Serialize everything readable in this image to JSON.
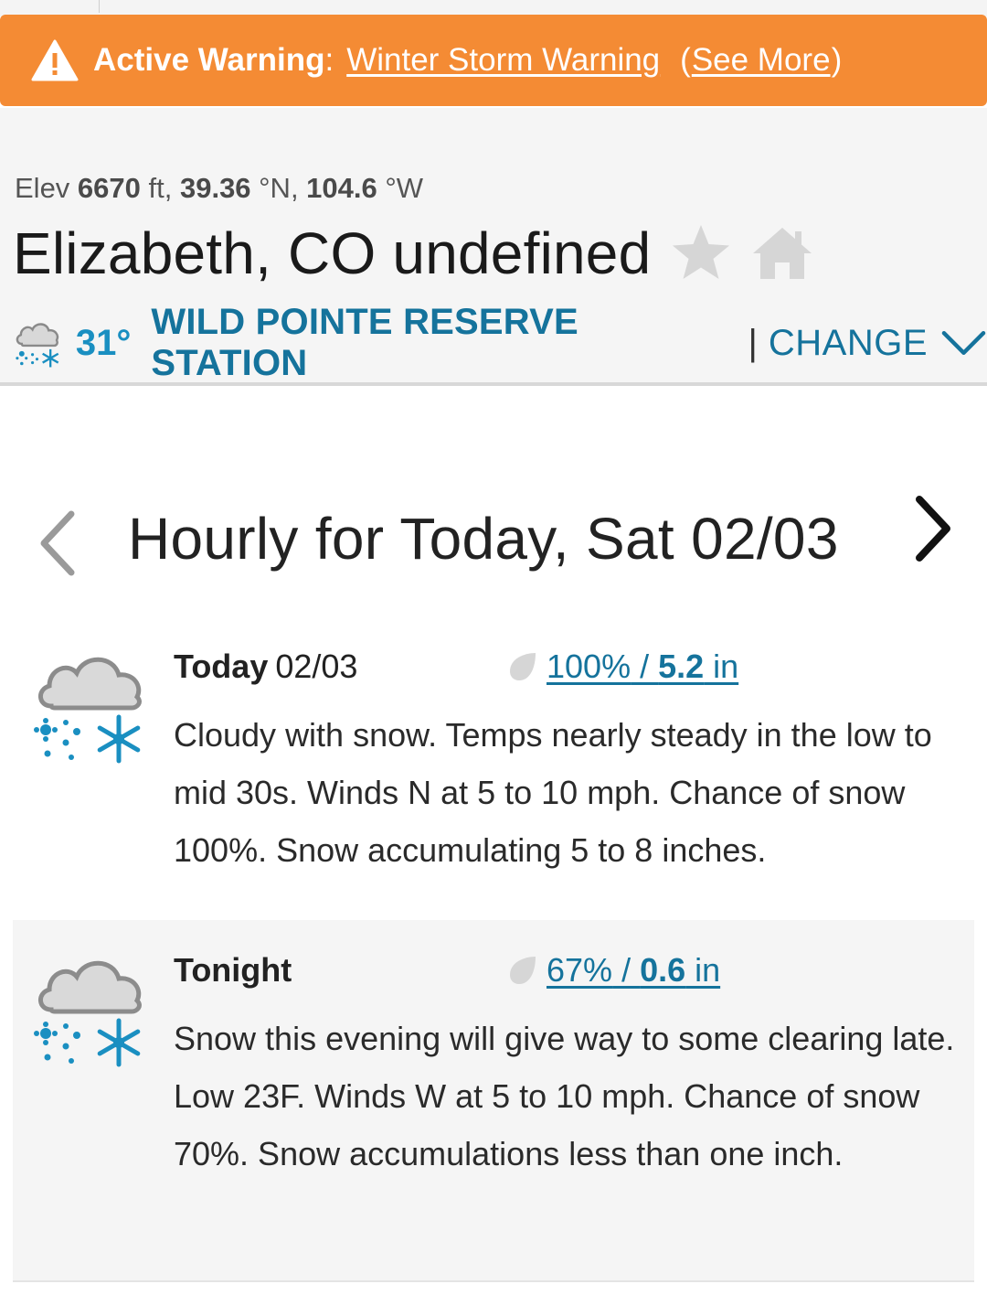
{
  "warning": {
    "label": "Active Warning",
    "colon": ":",
    "link_text": "Winter Storm Warning",
    "see_more_open": "(",
    "see_more_text": "See More",
    "see_more_close": ")",
    "icon": "warning-triangle-icon"
  },
  "location": {
    "elev_prefix": "Elev ",
    "elev_value": "6670",
    "elev_unit": " ft, ",
    "lat_value": "39.36",
    "lat_unit": " °N, ",
    "lon_value": "104.6",
    "lon_unit": " °W",
    "city": "Elizabeth, CO undefined",
    "favorite_icon": "star-icon",
    "home_icon": "home-icon"
  },
  "station": {
    "icon": "snow-cloud-icon",
    "temp": "31°",
    "name": "WILD POINTE RESERVE STATION",
    "separator": "|",
    "change_label": "CHANGE",
    "dropdown_icon": "chevron-down-icon"
  },
  "hourly": {
    "title": "Hourly for Today, Sat 02/03",
    "prev_icon": "chevron-left-icon",
    "next_icon": "chevron-right-icon"
  },
  "forecasts": [
    {
      "day": "Today",
      "date": "02/03",
      "precip_pct": "100%",
      "precip_sep": " / ",
      "precip_amount": "5.2",
      "precip_unit": " in",
      "text": "Cloudy with snow. Temps nearly steady in the low to mid 30s. Winds N at 5 to 10 mph. Chance of snow 100%. Snow accumulating 5 to 8 inches.",
      "icon": "snow-cloud-icon"
    },
    {
      "day": "Tonight",
      "date": "",
      "precip_pct": "67%",
      "precip_sep": " / ",
      "precip_amount": "0.6",
      "precip_unit": " in",
      "text": "Snow this evening will give way to some clearing late. Low 23F. Winds W at 5 to 10 mph. Chance of snow 70%. Snow accumulations less than one inch.",
      "icon": "snow-cloud-icon"
    }
  ],
  "colors": {
    "warning_bg": "#f48b34",
    "link_blue": "#15739c",
    "temp_blue": "#1a8fc1",
    "snow_blue": "#1a8fc1"
  }
}
